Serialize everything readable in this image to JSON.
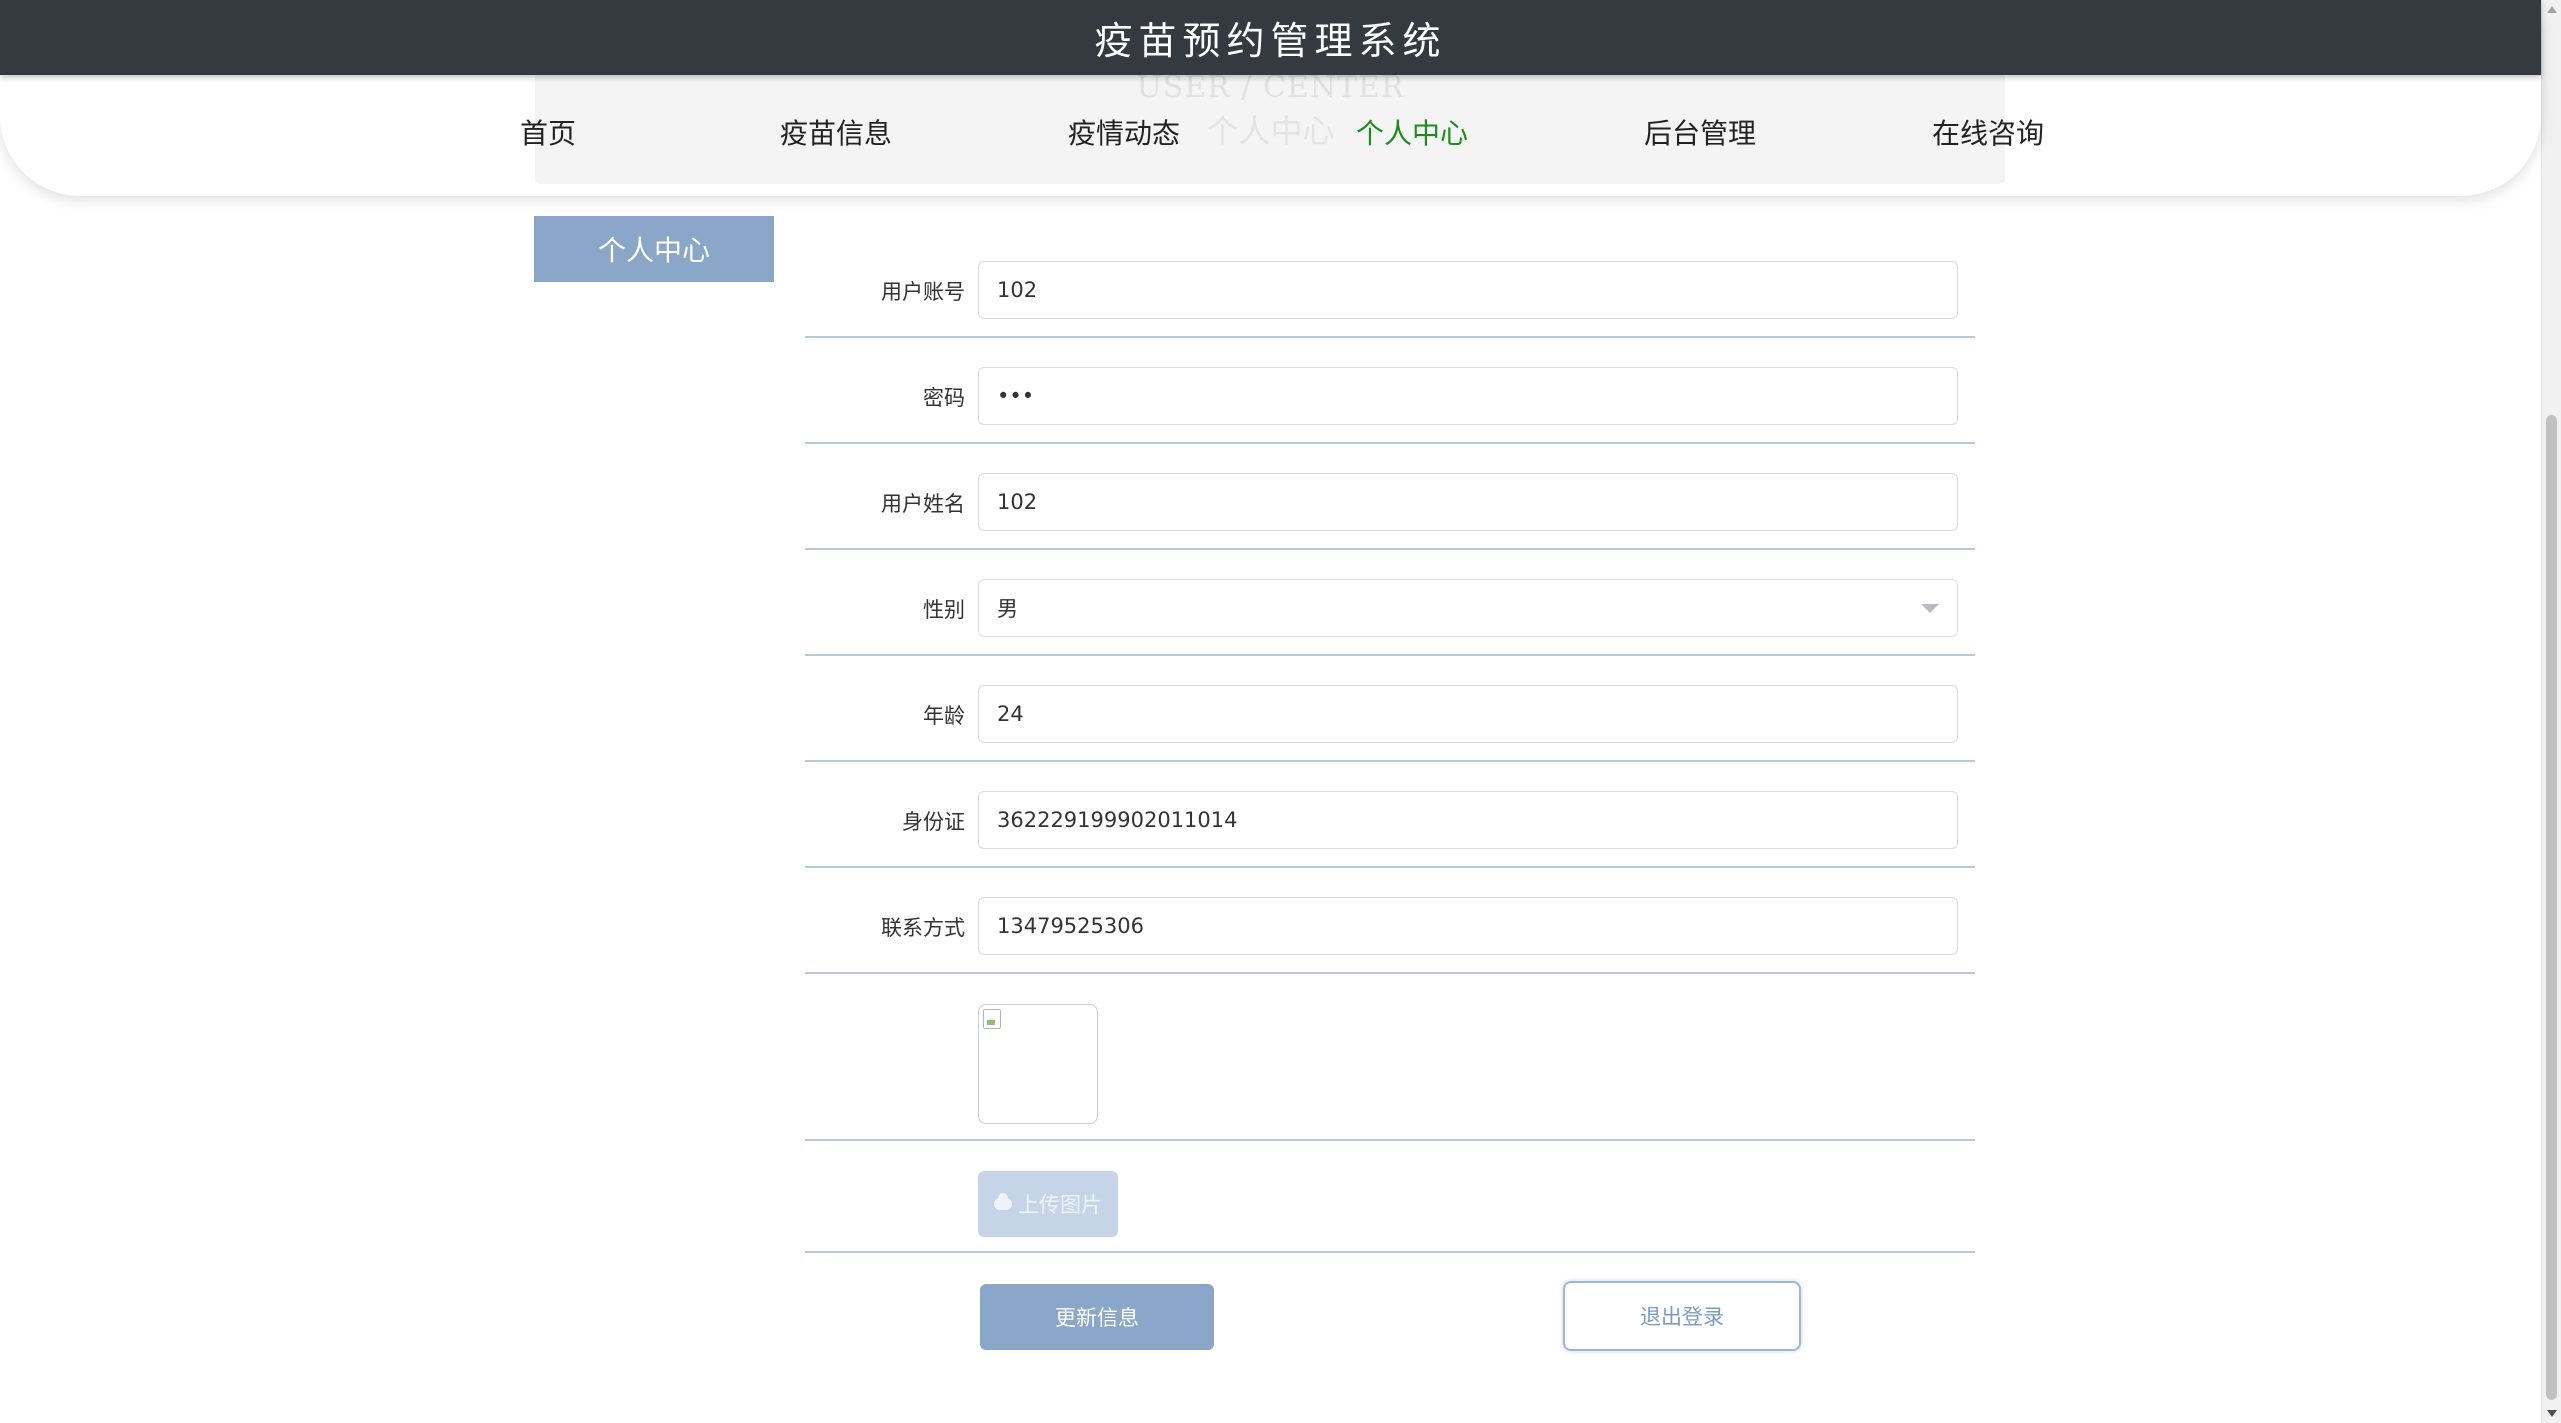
{
  "app": {
    "title": "疫苗预约管理系统"
  },
  "header_ghost": {
    "en": "USER / CENTER",
    "cn": "个人中心"
  },
  "nav": {
    "items": [
      {
        "label": "首页"
      },
      {
        "label": "疫苗信息"
      },
      {
        "label": "疫情动态"
      },
      {
        "label": "个人中心",
        "active": true
      },
      {
        "label": "后台管理"
      },
      {
        "label": "在线咨询"
      }
    ],
    "active_color": "#1f8a1f"
  },
  "side": {
    "tab_label": "个人中心"
  },
  "form": {
    "account": {
      "label": "用户账号",
      "value": "102"
    },
    "password": {
      "label": "密码",
      "value": "•••"
    },
    "name": {
      "label": "用户姓名",
      "value": "102"
    },
    "gender": {
      "label": "性别",
      "value": "男"
    },
    "age": {
      "label": "年龄",
      "value": "24"
    },
    "id_card": {
      "label": "身份证",
      "value": "362229199902011014"
    },
    "phone": {
      "label": "联系方式",
      "value": "13479525306"
    },
    "upload_label": "上传图片"
  },
  "actions": {
    "update_label": "更新信息",
    "logout_label": "退出登录"
  },
  "colors": {
    "primary": "#8aa6c9",
    "topbar": "#343a40",
    "row_border": "#b7c9df"
  }
}
